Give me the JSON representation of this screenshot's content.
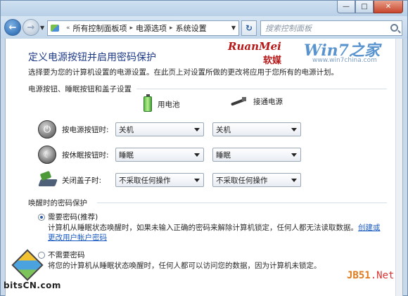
{
  "window": {
    "buttons": {
      "minimize": "—",
      "maximize": "□",
      "close": "✕"
    }
  },
  "nav": {
    "back_glyph": "←",
    "forward_glyph": "→",
    "breadcrumb_lead": "«",
    "breadcrumbs": [
      "所有控制面板项",
      "电源选项",
      "系统设置"
    ],
    "breadcrumb_sep": "▸",
    "refresh_glyph": "↻",
    "search_placeholder": "搜索控制面板"
  },
  "branding": {
    "site1_en": "RuanMei",
    "site1_cn": "软媒",
    "site2_title": "Win7之家",
    "site2_url": "www.win7china.com"
  },
  "page": {
    "title": "定义电源按钮并启用密码保护",
    "description": "选择要为您的计算机设置的电源设置。在此页上对设置所做的更改将应用于您所有的电源计划。"
  },
  "power_section": {
    "title": "电源按钮、睡眠按钮和盖子设置",
    "col_battery": "用电池",
    "col_plugged": "接通电源",
    "rows": [
      {
        "label": "按电源按钮时:",
        "battery": "关机",
        "plugged": "关机"
      },
      {
        "label": "按休眠按钮时:",
        "battery": "睡眠",
        "plugged": "睡眠"
      },
      {
        "label": "关闭盖子时:",
        "battery": "不采取任何操作",
        "plugged": "不采取任何操作"
      }
    ]
  },
  "wake_section": {
    "title": "唤醒时的密码保护",
    "options": [
      {
        "label": "需要密码(推荐)",
        "selected": true,
        "desc": "计算机从睡眠状态唤醒时，如果未输入正确的密码来解除计算机锁定，任何人都无法读取数据。",
        "link": "创建或更改用户帐户密码"
      },
      {
        "label": "不需要密码",
        "selected": false,
        "desc": "将您的计算机从睡眠状态唤醒时，任何人都可以访问您的数据，因为计算机未锁定。"
      }
    ]
  },
  "watermarks": {
    "left": "bitsCN.com",
    "right_a": "JB51",
    "right_b": ".Net"
  }
}
